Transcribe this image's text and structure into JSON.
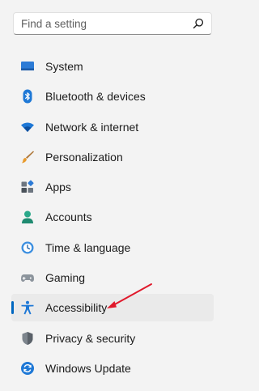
{
  "search": {
    "placeholder": "Find a setting",
    "value": ""
  },
  "nav": {
    "items": [
      {
        "label": "System",
        "icon": "monitor-icon"
      },
      {
        "label": "Bluetooth & devices",
        "icon": "bluetooth-icon"
      },
      {
        "label": "Network & internet",
        "icon": "wifi-icon"
      },
      {
        "label": "Personalization",
        "icon": "paintbrush-icon"
      },
      {
        "label": "Apps",
        "icon": "apps-icon"
      },
      {
        "label": "Accounts",
        "icon": "person-icon"
      },
      {
        "label": "Time & language",
        "icon": "globe-clock-icon"
      },
      {
        "label": "Gaming",
        "icon": "gamepad-icon"
      },
      {
        "label": "Accessibility",
        "icon": "accessibility-icon",
        "selected": true
      },
      {
        "label": "Privacy & security",
        "icon": "shield-icon"
      },
      {
        "label": "Windows Update",
        "icon": "refresh-icon"
      }
    ]
  },
  "colors": {
    "accent": "#0067c0",
    "selection_bg": "#eaeaea",
    "window_bg": "#f3f3f3",
    "annotation_arrow": "#e0192b"
  }
}
